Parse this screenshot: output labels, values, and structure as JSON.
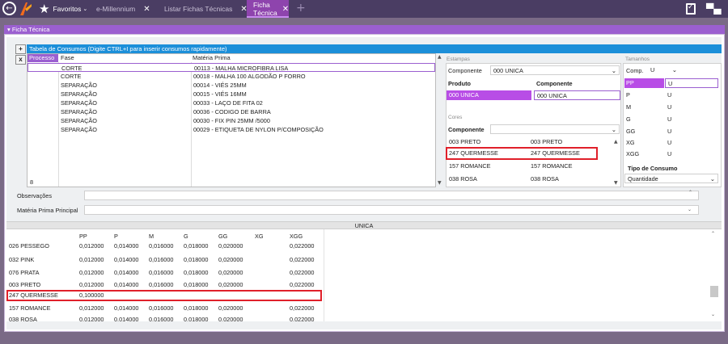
{
  "topbar": {
    "back_icon": "←",
    "favoritos": "Favoritos",
    "tabs": [
      {
        "label": "e-Millennium",
        "close": "✕"
      },
      {
        "label": "Listar Fichas Técnicas",
        "close": "✕"
      },
      {
        "label": "Ficha Técnica",
        "close": "✕"
      }
    ],
    "plus": "+",
    "chat_icon": "▀▄"
  },
  "panel": {
    "title": "▾ Ficha Técnica"
  },
  "consumos": {
    "header": "Tabela de Consumos  (Digite  CTRL+I para inserir consumos rapidamente)",
    "btn_add": "+",
    "btn_del": "x",
    "col_processo": "Processo",
    "col_fase": "Fase",
    "col_materia": "Matéria Prima",
    "rows": [
      {
        "fase": "CORTE",
        "materia": "00113 - MALHA MICROFIBRA LISA"
      },
      {
        "fase": "CORTE",
        "materia": "00018 - MALHA 100 ALGODÃO P FORRO"
      },
      {
        "fase": "SEPARAÇÃO",
        "materia": "00014 - VIÉS 25MM"
      },
      {
        "fase": "SEPARAÇÃO",
        "materia": "00015 - VIÉS 16MM"
      },
      {
        "fase": "SEPARAÇÃO",
        "materia": "00033 - LAÇO DE FITA 02"
      },
      {
        "fase": "SEPARAÇÃO",
        "materia": "00036 - CODIGO DE BARRA"
      },
      {
        "fase": "SEPARAÇÃO",
        "materia": "00030 - FIX PIN 25MM /5000"
      },
      {
        "fase": "SEPARAÇÃO",
        "materia": "00029 - ETIQUETA DE NYLON P/COMPOSIÇÃO"
      }
    ],
    "count": "8"
  },
  "estampas": {
    "label": "Estampas",
    "componente_label": "Componente",
    "componente_value": "000 UNICA",
    "col_produto": "Produto",
    "col_componente": "Componente",
    "row_produto": "000 UNICA",
    "row_componente": "000 UNICA"
  },
  "cores": {
    "label": "Cores",
    "componente_label": "Componente",
    "rows": [
      {
        "produto": "003 PRETO",
        "componente": "003 PRETO"
      },
      {
        "produto": "247 QUERMESSE",
        "componente": "247 QUERMESSE"
      },
      {
        "produto": "157 ROMANCE",
        "componente": "157 ROMANCE"
      },
      {
        "produto": "038 ROSA",
        "componente": "038 ROSA"
      }
    ]
  },
  "tamanhos": {
    "label": "Tamanhos",
    "comp_label": "Comp.",
    "comp_value": "U",
    "rows": [
      {
        "t": "PP",
        "c": "U"
      },
      {
        "t": "P",
        "c": "U"
      },
      {
        "t": "M",
        "c": "U"
      },
      {
        "t": "G",
        "c": "U"
      },
      {
        "t": "GG",
        "c": "U"
      },
      {
        "t": "XG",
        "c": "U"
      },
      {
        "t": "XGG",
        "c": "U"
      }
    ],
    "tipo_label": "Tipo de Consumo",
    "tipo_value": "Quantidade"
  },
  "form": {
    "observacoes": "Observações",
    "materia_principal": "Matéria Prima Principal"
  },
  "grid": {
    "title": "UNICA",
    "headers": [
      "PP",
      "P",
      "M",
      "G",
      "GG",
      "XG",
      "XGG"
    ],
    "rows": [
      {
        "cor": "026 PESSEGO",
        "v": [
          "0,012000",
          "0,014000",
          "0,016000",
          "0,018000",
          "0,020000",
          "",
          "0,022000"
        ]
      },
      {
        "cor": "032 PINK",
        "v": [
          "0,012000",
          "0,014000",
          "0,016000",
          "0,018000",
          "0,020000",
          "",
          "0,022000"
        ]
      },
      {
        "cor": "076 PRATA",
        "v": [
          "0,012000",
          "0,014000",
          "0,016000",
          "0,018000",
          "0,020000",
          "",
          "0,022000"
        ]
      },
      {
        "cor": "003 PRETO",
        "v": [
          "0,012000",
          "0,014000",
          "0,016000",
          "0,018000",
          "0,020000",
          "",
          "0,022000"
        ]
      },
      {
        "cor": "247 QUERMESSE",
        "v": [
          "0,100000",
          "",
          "",
          "",
          "",
          "",
          ""
        ]
      },
      {
        "cor": "157 ROMANCE",
        "v": [
          "0,012000",
          "0,014000",
          "0,016000",
          "0,018000",
          "0,020000",
          "",
          "0,022000"
        ]
      },
      {
        "cor": "038 ROSA",
        "v": [
          "0,012000",
          "0,014000",
          "0,016000",
          "0,018000",
          "0,020000",
          "",
          "0,022000"
        ]
      }
    ]
  },
  "colors": {
    "accent": "#9b5fd0",
    "header_blue": "#1c8fd9",
    "highlight_red": "#e0202a",
    "topbar": "#4a3d63"
  }
}
